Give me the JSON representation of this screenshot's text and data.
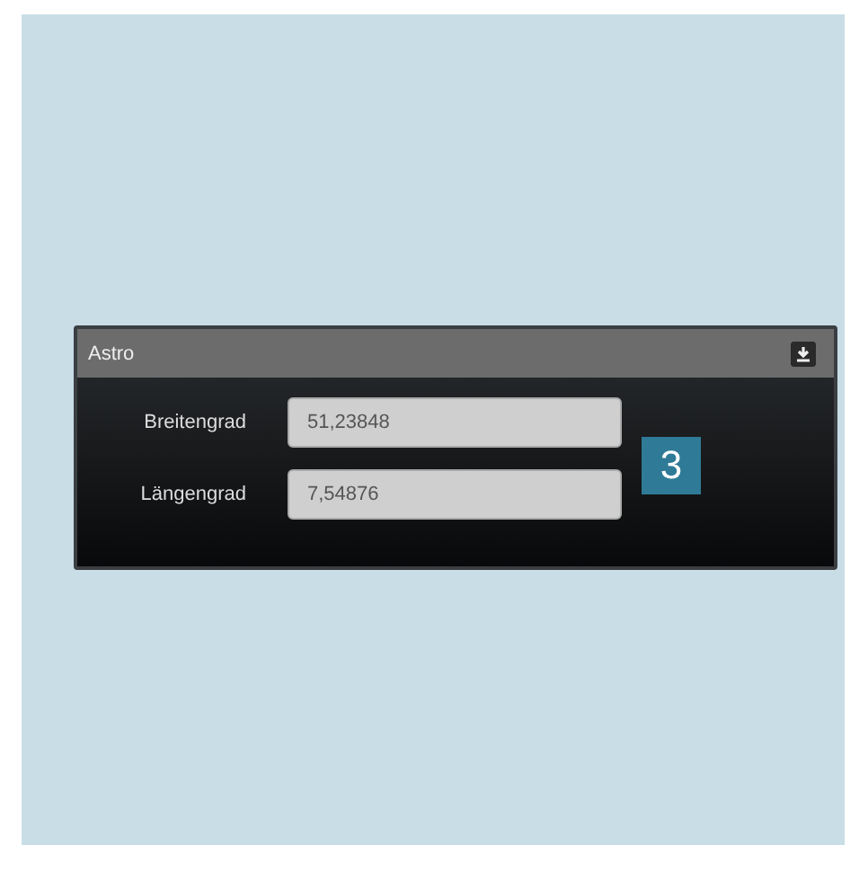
{
  "panel": {
    "title": "Astro"
  },
  "fields": [
    {
      "label": "Breitengrad",
      "value": "51,23848"
    },
    {
      "label": "Längengrad",
      "value": "7,54876"
    }
  ],
  "callout": "3"
}
